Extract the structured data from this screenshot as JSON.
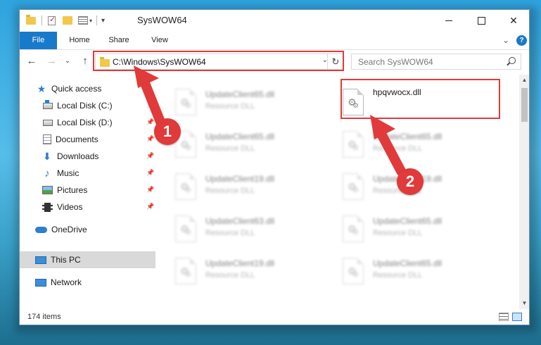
{
  "window": {
    "title": "SysWOW64",
    "minimize_glyph": "",
    "maximize_glyph": "",
    "close_glyph": "✕"
  },
  "ribbon": {
    "tabs": [
      "File",
      "Home",
      "Share",
      "View"
    ],
    "expand_glyph": "⌄",
    "help_glyph": "?"
  },
  "navigation": {
    "back_glyph": "←",
    "forward_glyph": "→",
    "recent_glyph": "⌄",
    "up_glyph": "↑",
    "address": "C:\\Windows\\SysWOW64",
    "address_dropdown_glyph": "⌄",
    "refresh_glyph": "↻",
    "search_placeholder": "Search SysWOW64"
  },
  "sidebar": {
    "items": [
      {
        "label": "Quick access",
        "icon": "star-icon",
        "pinned": false
      },
      {
        "label": "Local Disk (C:)",
        "icon": "drive-c-icon",
        "pinned": true
      },
      {
        "label": "Local Disk (D:)",
        "icon": "drive-d-icon",
        "pinned": true
      },
      {
        "label": "Documents",
        "icon": "documents-icon",
        "pinned": true
      },
      {
        "label": "Downloads",
        "icon": "downloads-icon",
        "pinned": true
      },
      {
        "label": "Music",
        "icon": "music-icon",
        "pinned": true
      },
      {
        "label": "Pictures",
        "icon": "pictures-icon",
        "pinned": true
      },
      {
        "label": "Videos",
        "icon": "videos-icon",
        "pinned": true
      },
      {
        "label": "OneDrive",
        "icon": "onedrive-icon",
        "pinned": false
      },
      {
        "label": "This PC",
        "icon": "this-pc-icon",
        "pinned": false,
        "selected": true
      },
      {
        "label": "Network",
        "icon": "network-icon",
        "pinned": false
      }
    ],
    "pin_glyph": "📌"
  },
  "files": [
    {
      "name": "UpdateClient65.dll",
      "type": "Resource DLL",
      "blurred": true
    },
    {
      "name": "hpqvwocx.dll",
      "type": "",
      "blurred": false
    },
    {
      "name": "UpdateClient65.dll",
      "type": "Resource DLL",
      "blurred": true
    },
    {
      "name": "UpdateClient65.dll",
      "type": "Resource DLL",
      "blurred": true
    },
    {
      "name": "UpdateClient19.dll",
      "type": "Resource DLL",
      "blurred": true
    },
    {
      "name": "UpdateClient19.dll",
      "type": "Resource DLL",
      "blurred": true
    },
    {
      "name": "UpdateClient63.dll",
      "type": "Resource DLL",
      "blurred": true
    },
    {
      "name": "UpdateClient65.dll",
      "type": "Resource DLL",
      "blurred": true
    },
    {
      "name": "UpdateClient19.dll",
      "type": "Resource DLL",
      "blurred": true
    },
    {
      "name": "UpdateClient65.dll",
      "type": "Resource DLL",
      "blurred": true
    }
  ],
  "scrollbar": {
    "up_glyph": "▲",
    "down_glyph": "▼"
  },
  "status": {
    "item_count": "174 items"
  },
  "annotations": {
    "step1_label": "1",
    "step2_label": "2",
    "color": "#e03a3a"
  },
  "colors": {
    "accent": "#1979ca"
  }
}
